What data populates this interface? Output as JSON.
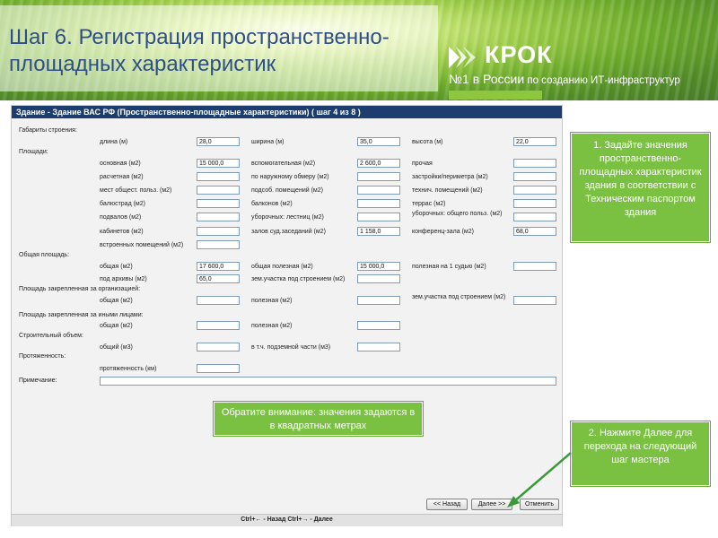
{
  "page": {
    "title": "Шаг 6. Регистрация пространственно-площадных характеристик"
  },
  "logo": {
    "name": "КРОК",
    "tagline_no": "№1 в России",
    "tagline_rest": " по созданию ИТ-инфраструктур"
  },
  "window": {
    "title": "Здание - Здание ВАС РФ (Пространственно-площадные характеристики) ( шаг 4 из 8 )"
  },
  "form": {
    "gabarity": {
      "section": "Габариты строения:",
      "dlina_label": "длина (м)",
      "dlina_value": "28,0",
      "shirina_label": "ширина (м)",
      "shirina_value": "35,0",
      "vysota_label": "высота (м)",
      "vysota_value": "22,0"
    },
    "ploshadi": {
      "section": "Площади:",
      "osnovnaya_label": "основная (м2)",
      "osnovnaya_value": "15 000,0",
      "vspomogatelnaya_label": "вспомогательная (м2)",
      "vspomogatelnaya_value": "2 600,0",
      "prochaya_label": "прочая",
      "prochaya_value": "",
      "raschetnaya_label": "расчетная (м2)",
      "raschetnaya_value": "",
      "po_obmeru_label": "по наружному обмеру (м2)",
      "po_obmeru_value": "",
      "zastroiki_label": "застройки/периметра (м2)",
      "zastroiki_value": "",
      "mest_label": "мест общест. польз. (м2)",
      "mest_value": "",
      "podsob_label": "подсоб. помещений (м2)",
      "podsob_value": "",
      "tehnich_label": "технич. помещений (м2)",
      "tehnich_value": "",
      "balkostrad_label": "балюстрад (м2)",
      "balkostrad_value": "",
      "balkonov_label": "балконов (м2)",
      "balkonov_value": "",
      "terras_label": "террас (м2)",
      "terras_value": "",
      "podvalov_label": "подвалов (м2)",
      "podvalov_value": "",
      "ubor_lestnic_label": "уборочных: лестниц (м2)",
      "ubor_lestnic_value": "",
      "ubor_obshego_label": "уборочных: общего польз. (м2)",
      "ubor_obshego_value": "",
      "kabinetov_label": "кабинетов (м2)",
      "kabinetov_value": "",
      "zalov_label": "залов суд.заседаний (м2)",
      "zalov_value": "1 158,0",
      "konferenc_label": "конференц-зала (м2)",
      "konferenc_value": "68,0",
      "vstroennyh_label": "встроенных помещений (м2)",
      "vstroennyh_value": ""
    },
    "obshaya": {
      "section": "Общая площадь:",
      "obshaya_label": "общая (м2)",
      "obshaya_value": "17 600,0",
      "poleznaya_label": "общая полезная (м2)",
      "poleznaya_value": "15 000,0",
      "na_sudyu_label": "полезная на 1 судью (м2)",
      "na_sudyu_value": "",
      "arhivy_label": "под архивы (м2)",
      "arhivy_value": "65,0",
      "zem_label": "зем.участка под строением (м2)",
      "zem_value": ""
    },
    "za_org": {
      "section": "Площадь закрепленная за организацией:",
      "obshaya_label": "общая (м2)",
      "obshaya_value": "",
      "poleznaya_label": "полезная (м2)",
      "poleznaya_value": "",
      "zem_label": "зем.участка под строением (м2)",
      "zem_value": ""
    },
    "za_lic": {
      "section": "Площадь закрепленная за иными лицами:",
      "obshaya_label": "общая (м2)",
      "obshaya_value": "",
      "poleznaya_label": "полезная (м2)",
      "poleznaya_value": ""
    },
    "obem": {
      "section": "Строительный объем:",
      "obshiy_label": "общий (м3)",
      "obshiy_value": "",
      "podzem_label": "в т.ч. подземной части (м3)",
      "podzem_value": ""
    },
    "protyazhennost": {
      "section": "Протяженность:",
      "label": "протяженность (км)",
      "value": ""
    },
    "primechanie": {
      "label": "Примечание:",
      "value": ""
    }
  },
  "buttons": {
    "back": "<< Назад",
    "next": "Далее >>",
    "cancel": "Отменить"
  },
  "status_bar": "Ctrl+← - Назад Ctrl+→ - Далее",
  "callouts": {
    "step1": "1. Задайте значения пространственно-площадных характеристик здания в соответствии с Техническим паспортом здания",
    "step2": "2. Нажмите Далее для перехода на следующий шаг мастера",
    "note": "Обратите внимание: значения задаются в в квадратных метрах"
  },
  "colors": {
    "title_text": "#2f4f86",
    "window_titlebar": "#1c3d6e",
    "callout_green": "#7ac142",
    "arrow_green": "#3a9a3a"
  }
}
